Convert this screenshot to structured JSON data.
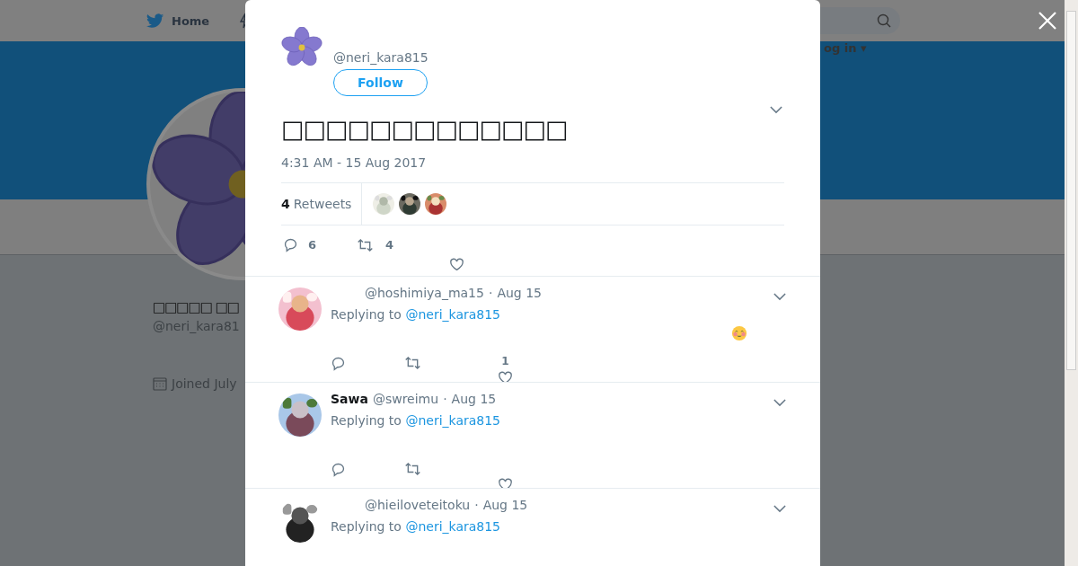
{
  "nav": {
    "home": "Home",
    "login": "og in ▾"
  },
  "profile": {
    "name": "□□□□□ □□",
    "handle": "@neri_kara81",
    "joined": "Joined July"
  },
  "tweet": {
    "handle": "@neri_kara815",
    "follow": "Follow",
    "text": "□□□□□□□□□□□□□",
    "timestamp": "4:31 AM - 15 Aug 2017",
    "retweet_count": "4",
    "retweet_label": "Retweets",
    "reply_count": "6",
    "retweet_total": "4"
  },
  "replies": [
    {
      "handle": "@hoshimiya_ma15",
      "separator": "·",
      "time": "Aug 15",
      "replying_label": "Replying to",
      "replying_to": "@neri_kara815",
      "body": {
        "kind": "emoji"
      },
      "like_count": "1"
    },
    {
      "name": "Sawa",
      "handle": "@swreimu",
      "separator": "·",
      "time": "Aug 15",
      "replying_label": "Replying to",
      "replying_to": "@neri_kara815"
    },
    {
      "handle": "@hieiloveteitoku",
      "separator": "·",
      "time": "Aug 15",
      "replying_label": "Replying to",
      "replying_to": "@neri_kara815"
    }
  ]
}
